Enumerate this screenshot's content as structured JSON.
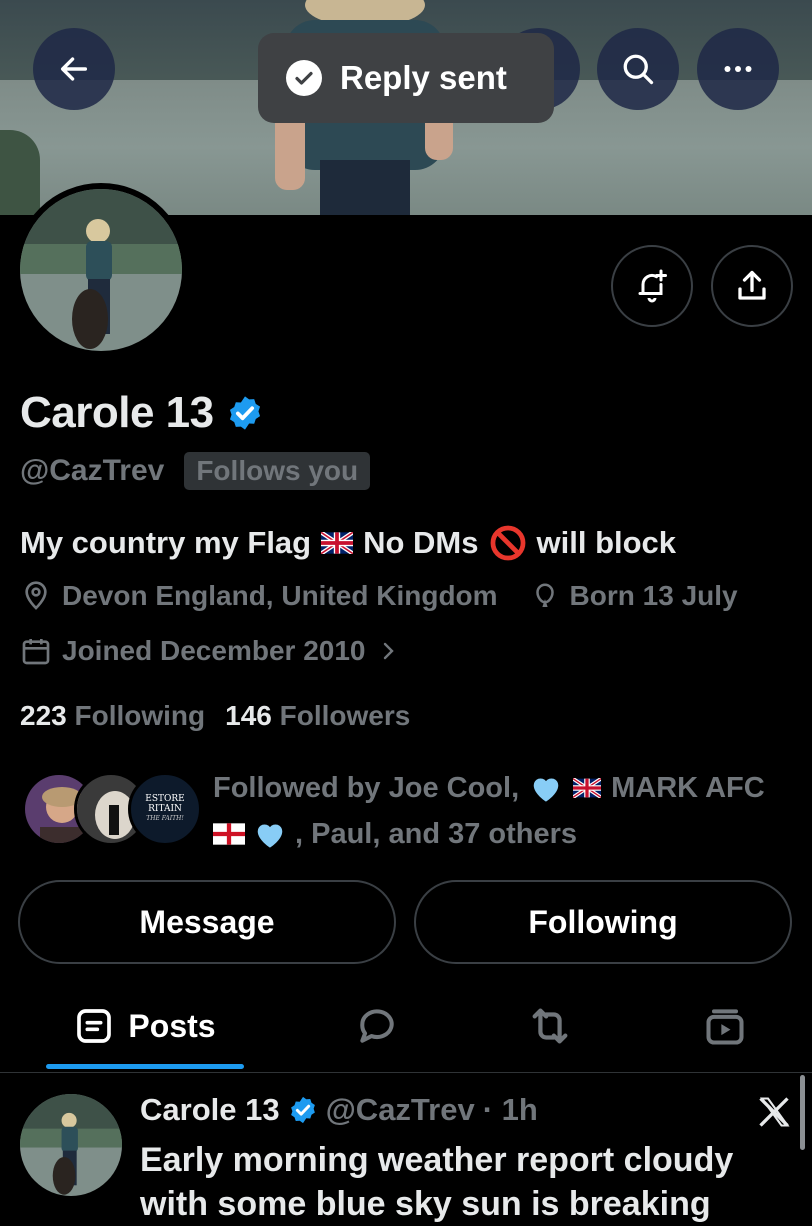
{
  "toast": {
    "text": "Reply sent"
  },
  "top_bar": {
    "back_icon": "arrow-left-icon",
    "search_icon": "search-icon",
    "more_icon": "more-horizontal-icon"
  },
  "profile": {
    "name": "Carole 13",
    "handle": "@CazTrev",
    "follows_you": "Follows you",
    "bio_part1": "My country my Flag",
    "bio_part2": "No DMs",
    "bio_part3": "will block",
    "location": "Devon England, United Kingdom",
    "born": "Born 13 July",
    "joined": "Joined December 2010",
    "following_count": "223",
    "following_label": "Following",
    "followers_count": "146",
    "followers_label": "Followers",
    "followed_by_line1": "Followed by Joe Cool,",
    "followed_by_line1b": "MARK AFC",
    "followed_by_line2": ", Paul, and 37 others",
    "avatar3_text_a": "ESTORE",
    "avatar3_text_b": "RITAIN",
    "avatar3_text_c": "THE FAITH!"
  },
  "buttons": {
    "message": "Message",
    "following": "Following"
  },
  "tabs": {
    "posts": "Posts"
  },
  "post": {
    "name": "Carole 13",
    "handle": "@CazTrev",
    "time": "· 1h",
    "text": "Early morning weather report cloudy",
    "text2": "with some blue sky sun is breaking"
  },
  "colors": {
    "accent": "#1d9bf0",
    "verified": "#1d9bf0",
    "background": "#000000",
    "muted": "#71767b"
  }
}
